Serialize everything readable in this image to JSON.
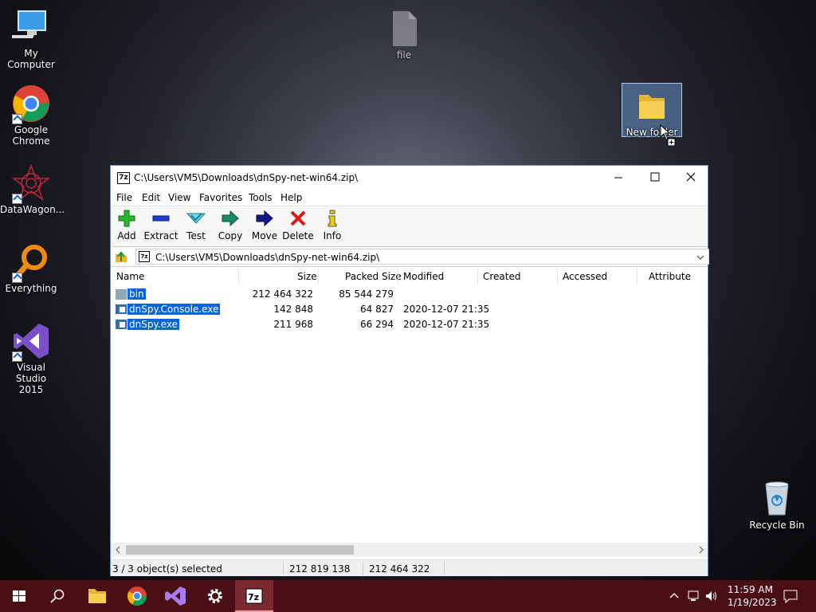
{
  "desktop": {
    "icons": [
      {
        "label": "My Computer",
        "icon": "computer-icon"
      },
      {
        "label": "Google Chrome",
        "icon": "chrome-icon"
      },
      {
        "label": "DataWagon...",
        "icon": "datawagon-icon"
      },
      {
        "label": "Everything",
        "icon": "everything-icon"
      },
      {
        "label": "Visual Studio 2015",
        "icon": "visual-studio-icon"
      },
      {
        "label": "file",
        "icon": "file-icon"
      },
      {
        "label": "New folder",
        "icon": "folder-icon"
      },
      {
        "label": "Recycle Bin",
        "icon": "recycle-bin-icon"
      }
    ]
  },
  "window": {
    "title": "C:\\Users\\VM5\\Downloads\\dnSpy-net-win64.zip\\",
    "menu": [
      "File",
      "Edit",
      "View",
      "Favorites",
      "Tools",
      "Help"
    ],
    "toolbar": [
      {
        "label": "Add",
        "icon": "add-icon",
        "color": "#2db52d"
      },
      {
        "label": "Extract",
        "icon": "extract-icon",
        "color": "#1f3bd6"
      },
      {
        "label": "Test",
        "icon": "test-icon",
        "color": "#19a8c0"
      },
      {
        "label": "Copy",
        "icon": "copy-icon",
        "color": "#1a8a6a"
      },
      {
        "label": "Move",
        "icon": "move-icon",
        "color": "#14148c"
      },
      {
        "label": "Delete",
        "icon": "delete-icon",
        "color": "#e01818"
      },
      {
        "label": "Info",
        "icon": "info-icon",
        "color": "#c8b400"
      }
    ],
    "address": "C:\\Users\\VM5\\Downloads\\dnSpy-net-win64.zip\\",
    "columns": [
      "Name",
      "Size",
      "Packed Size",
      "Modified",
      "Created",
      "Accessed",
      "Attribute"
    ],
    "rows": [
      {
        "name": "bin",
        "size": "212 464 322",
        "packed": "85 544 279",
        "modified": "",
        "type": "folder"
      },
      {
        "name": "dnSpy.Console.exe",
        "size": "142 848",
        "packed": "64 827",
        "modified": "2020-12-07 21:35",
        "type": "exe"
      },
      {
        "name": "dnSpy.exe",
        "size": "211 968",
        "packed": "66 294",
        "modified": "2020-12-07 21:35",
        "type": "exe"
      }
    ],
    "status": {
      "selected": "3 / 3 object(s) selected",
      "size": "212 819 138",
      "packed": "212 464 322"
    }
  },
  "taskbar": {
    "time": "11:59 AM",
    "date": "1/19/2023",
    "accent": "#4a0f14"
  }
}
